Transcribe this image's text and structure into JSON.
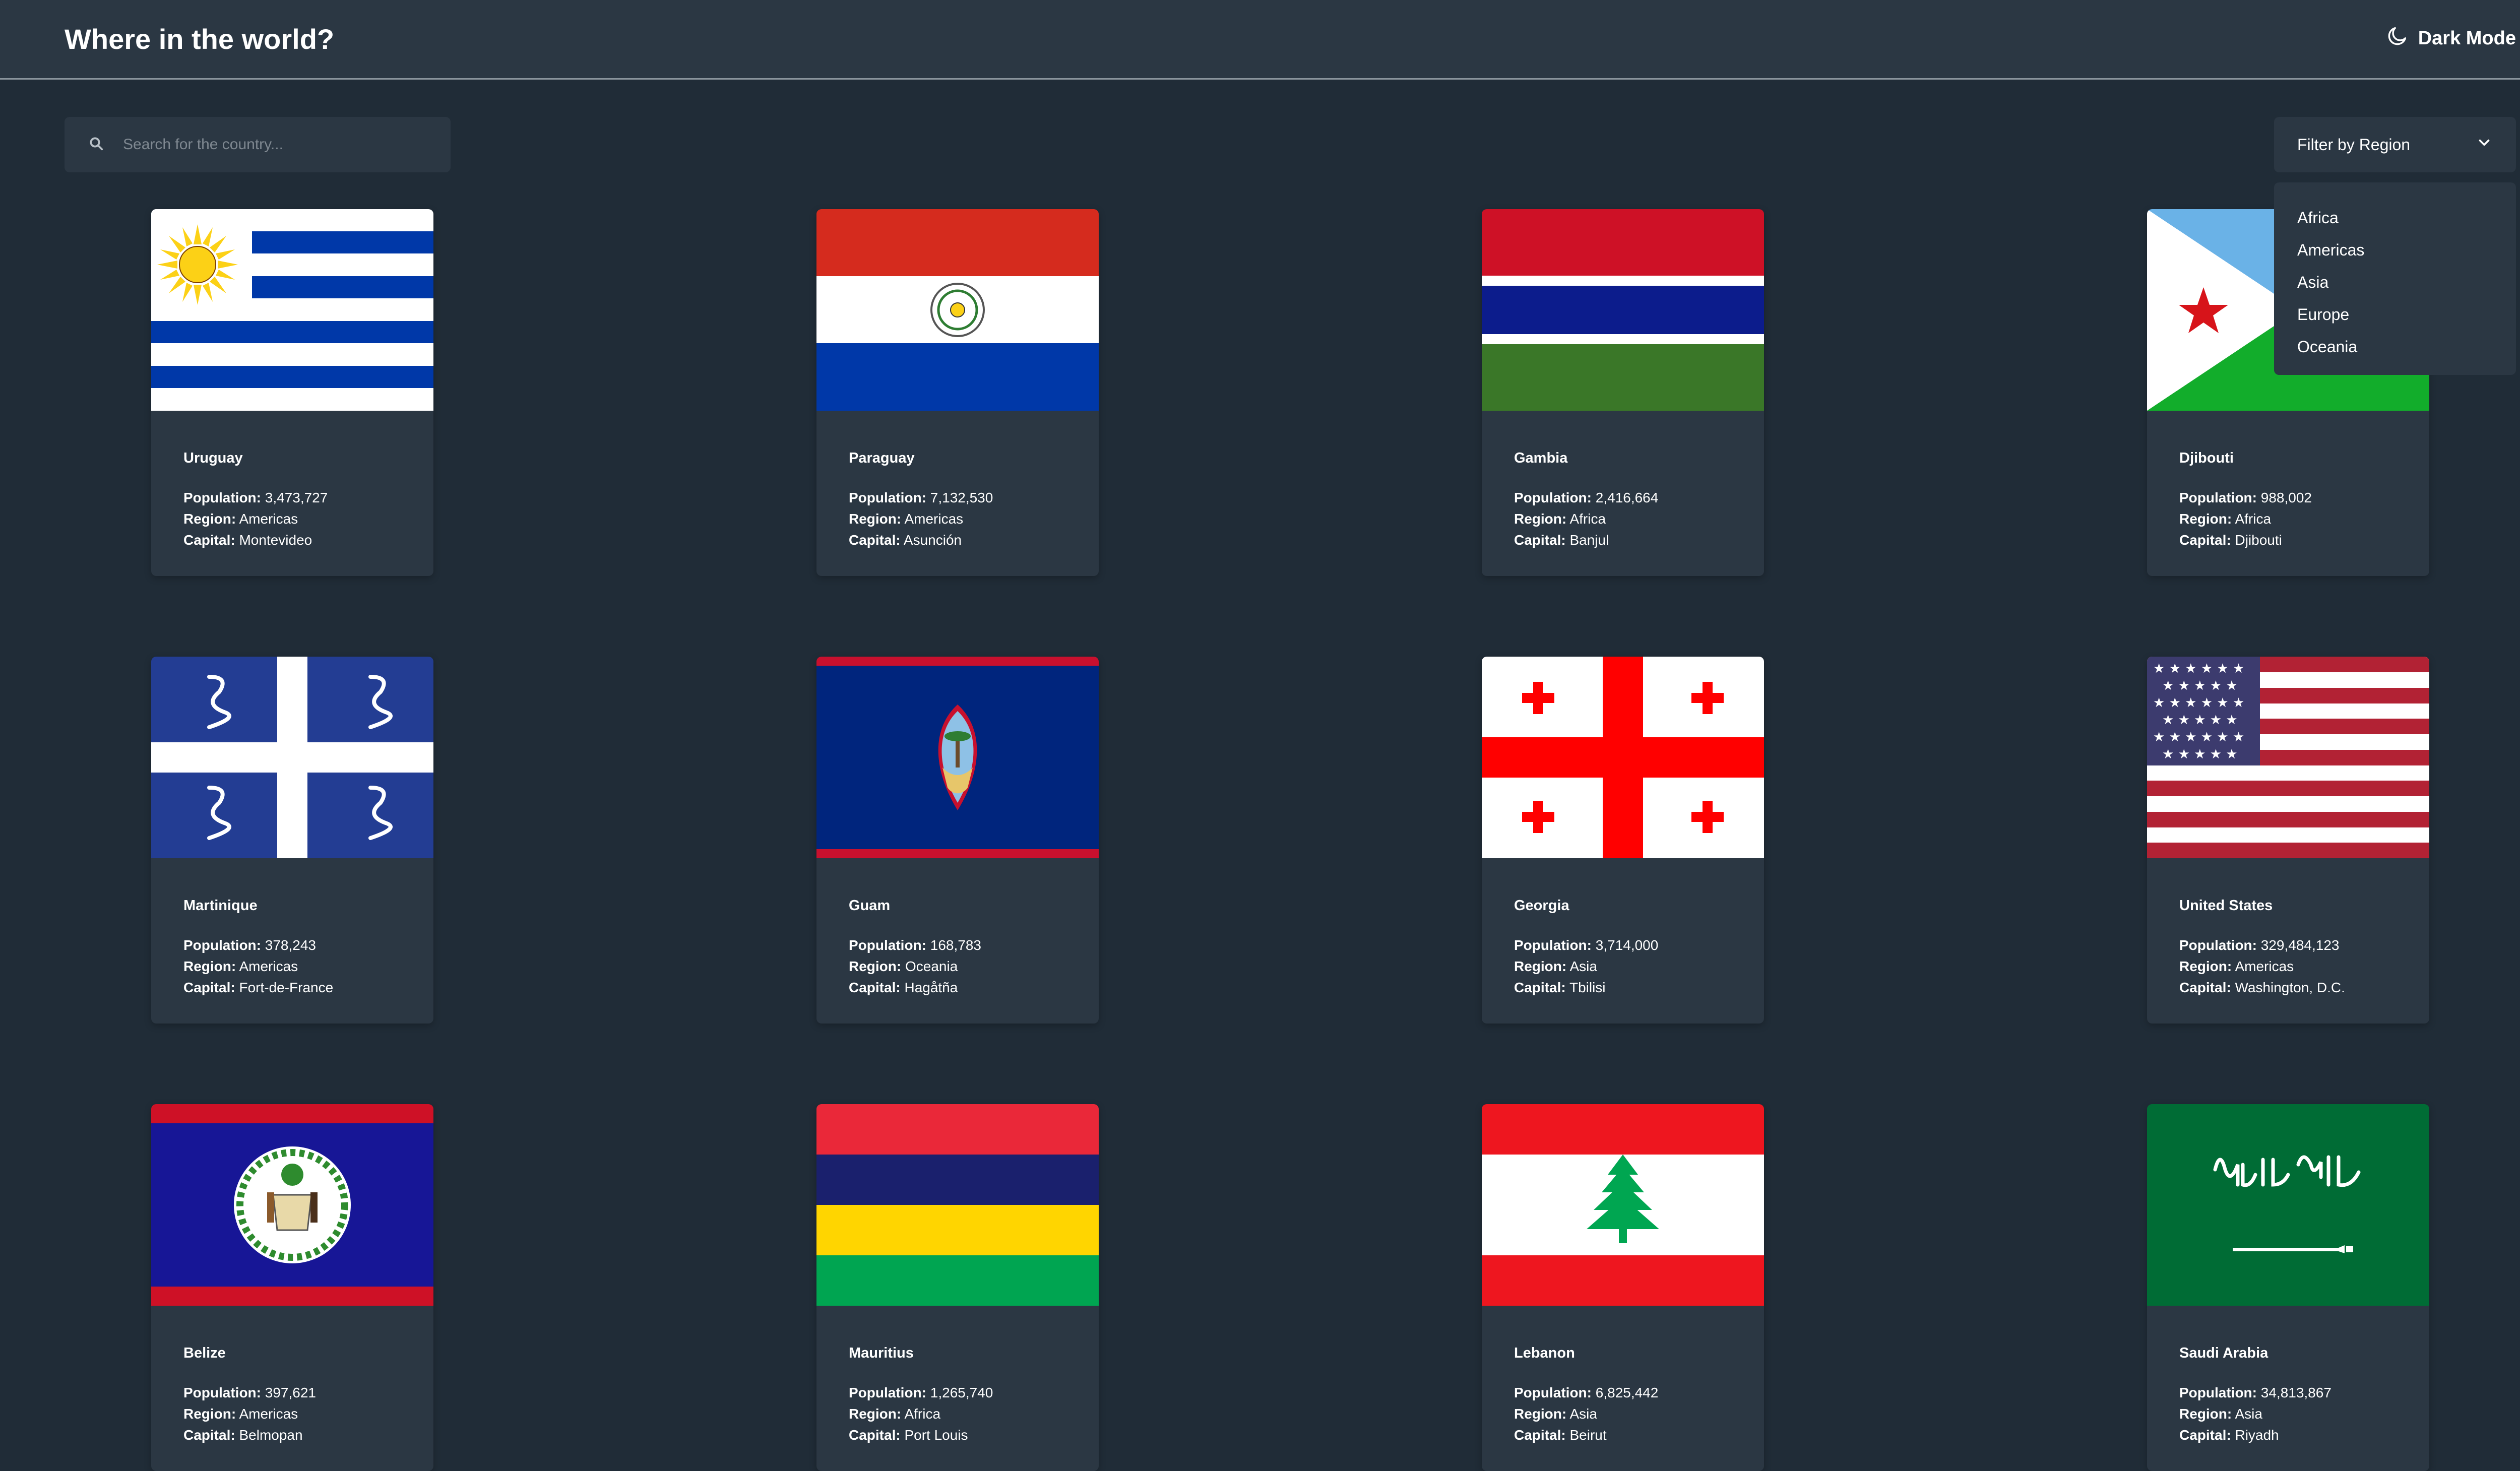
{
  "header": {
    "title": "Where in the world?",
    "mode_label": "Dark Mode"
  },
  "search": {
    "placeholder": "Search for the country..."
  },
  "filter": {
    "label": "Filter by Region",
    "options": [
      "Africa",
      "Americas",
      "Asia",
      "Europe",
      "Oceania"
    ]
  },
  "labels": {
    "population": "Population:",
    "region": "Region:",
    "capital": "Capital:"
  },
  "colors": {
    "background": "#202c37",
    "element": "#2b3743",
    "text": "#ffffff"
  },
  "countries": [
    {
      "name": "Uruguay",
      "population": "3,473,727",
      "region": "Americas",
      "capital": "Montevideo",
      "flag_icon": "uruguay-flag"
    },
    {
      "name": "Paraguay",
      "population": "7,132,530",
      "region": "Americas",
      "capital": "Asunción",
      "flag_icon": "paraguay-flag"
    },
    {
      "name": "Gambia",
      "population": "2,416,664",
      "region": "Africa",
      "capital": "Banjul",
      "flag_icon": "gambia-flag"
    },
    {
      "name": "Djibouti",
      "population": "988,002",
      "region": "Africa",
      "capital": "Djibouti",
      "flag_icon": "djibouti-flag"
    },
    {
      "name": "Martinique",
      "population": "378,243",
      "region": "Americas",
      "capital": "Fort-de-France",
      "flag_icon": "martinique-flag"
    },
    {
      "name": "Guam",
      "population": "168,783",
      "region": "Oceania",
      "capital": "Hagåtña",
      "flag_icon": "guam-flag"
    },
    {
      "name": "Georgia",
      "population": "3,714,000",
      "region": "Asia",
      "capital": "Tbilisi",
      "flag_icon": "georgia-flag"
    },
    {
      "name": "United States",
      "population": "329,484,123",
      "region": "Americas",
      "capital": "Washington, D.C.",
      "flag_icon": "united-states-flag"
    },
    {
      "name": "Belize",
      "population": "397,621",
      "region": "Americas",
      "capital": "Belmopan",
      "flag_icon": "belize-flag"
    },
    {
      "name": "Mauritius",
      "population": "1,265,740",
      "region": "Africa",
      "capital": "Port Louis",
      "flag_icon": "mauritius-flag"
    },
    {
      "name": "Lebanon",
      "population": "6,825,442",
      "region": "Asia",
      "capital": "Beirut",
      "flag_icon": "lebanon-flag"
    },
    {
      "name": "Saudi Arabia",
      "population": "34,813,867",
      "region": "Asia",
      "capital": "Riyadh",
      "flag_icon": "saudi-arabia-flag"
    }
  ]
}
